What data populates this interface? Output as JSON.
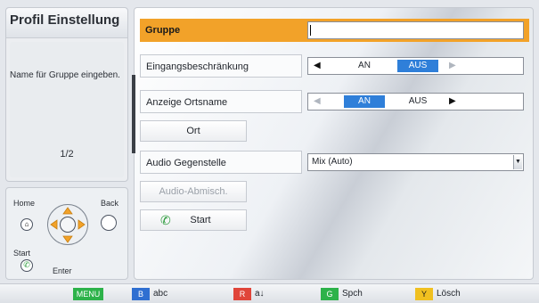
{
  "left_panel": {
    "title": "Profil Einstellung",
    "help_text": "Name für Gruppe eingeben.",
    "page_indicator": "1/2"
  },
  "remote": {
    "home_label": "Home",
    "back_label": "Back",
    "start_label": "Start",
    "enter_label": "Enter"
  },
  "form": {
    "group": {
      "label": "Gruppe",
      "value": ""
    },
    "input_restriction": {
      "label": "Eingangsbeschränkung",
      "option_on": "AN",
      "option_off": "AUS",
      "selected": "AUS"
    },
    "location_display": {
      "label": "Anzeige Ortsname",
      "option_on": "AN",
      "option_off": "AUS",
      "selected": "AN"
    },
    "location_button": "Ort",
    "audio_remote": {
      "label": "Audio Gegenstelle",
      "value": "Mix (Auto)"
    },
    "audio_mix_button": "Audio-Abmisch.",
    "start_button": "Start"
  },
  "footer": {
    "menu_key": "MENU",
    "blue_key": "B",
    "blue_label": "abc",
    "red_key": "R",
    "red_label": "a↓",
    "green_key": "G",
    "green_label": "Spch",
    "yellow_key": "Y",
    "yellow_label": "Lösch"
  },
  "colors": {
    "selected_row": "#f2a229",
    "toggle_active": "#2f7fd9",
    "green_key": "#2db24a",
    "red_key": "#e0453a",
    "blue_key": "#2f6fd1",
    "yellow_key": "#f0c020"
  }
}
